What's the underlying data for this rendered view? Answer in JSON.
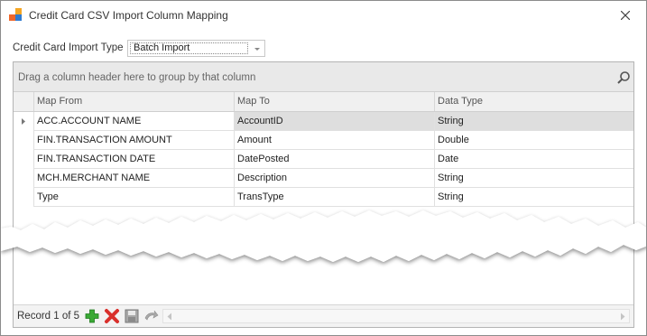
{
  "window": {
    "title": "Credit Card CSV Import Column Mapping",
    "icon": "app-icon",
    "close_icon": "close-icon"
  },
  "import_type": {
    "label": "Credit Card Import Type",
    "value": "Batch Import"
  },
  "grid": {
    "group_panel_text": "Drag a column header here to group by that column",
    "columns": [
      "Map From",
      "Map To",
      "Data Type"
    ],
    "rows": [
      {
        "map_from": "ACC.ACCOUNT NAME",
        "map_to": "AccountID",
        "data_type": "String"
      },
      {
        "map_from": "FIN.TRANSACTION AMOUNT",
        "map_to": "Amount",
        "data_type": "Double"
      },
      {
        "map_from": "FIN.TRANSACTION DATE",
        "map_to": "DatePosted",
        "data_type": "Date"
      },
      {
        "map_from": "MCH.MERCHANT NAME",
        "map_to": "Description",
        "data_type": "String"
      },
      {
        "map_from": "Type",
        "map_to": "TransType",
        "data_type": "String"
      }
    ],
    "selected_row_index": 0
  },
  "navigator": {
    "record_text": "Record 1 of 5",
    "buttons": [
      "add-icon",
      "delete-icon",
      "save-icon",
      "undo-icon"
    ]
  },
  "colors": {
    "accent_orange": "#f0672a",
    "accent_blue": "#2f7bd0",
    "add_green": "#3aa935",
    "delete_red": "#d9302c"
  }
}
